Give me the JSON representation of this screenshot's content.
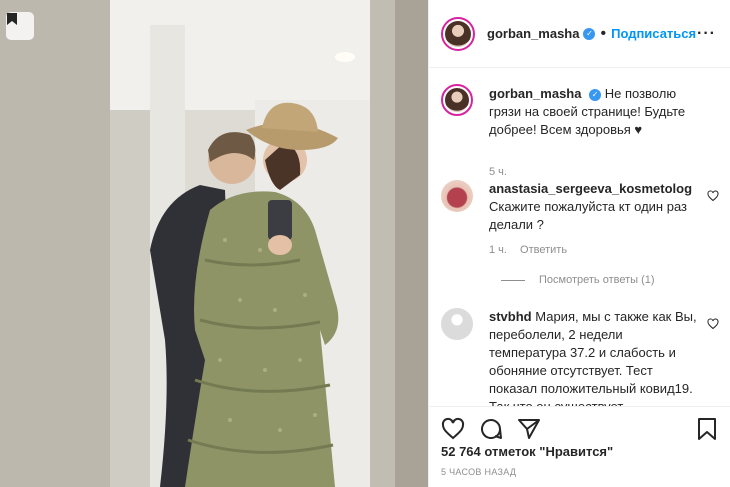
{
  "post": {
    "username": "gorban_masha",
    "follow_label": "Подписаться",
    "caption_user": "gorban_masha",
    "caption_text": "Не позволю грязи на своей странице! Будьте добрее! Всем здоровья ♥",
    "caption_time": "5 ч.",
    "likes_text": "52 764 отметок \"Нравится\"",
    "date_text": "5 часов назад"
  },
  "comments": [
    {
      "user": "anastasia_sergeeva_kosmetolog",
      "text": "Скажите пожалуйста кт один раз делали ?",
      "time": "1 ч.",
      "reply_label": "Ответить",
      "view_replies": "Посмотреть ответы (1)"
    },
    {
      "user": "stvbhd",
      "text": "Мария, мы с также как Вы, переболели, 2 недели температура 37.2 и слабость и обоняние отсутствует. Тест показал положительный ковид19. Так что он существует"
    }
  ],
  "icons": {
    "save": "bookmark-icon",
    "verified": "verified-badge-icon",
    "more": "more-options-icon",
    "like": "heart-icon",
    "comment": "comment-icon",
    "share": "share-icon",
    "bookmark": "bookmark-icon"
  },
  "colors": {
    "accent": "#0095f6",
    "verified": "#3897f0",
    "muted": "#8e8e8e",
    "text": "#262626"
  }
}
